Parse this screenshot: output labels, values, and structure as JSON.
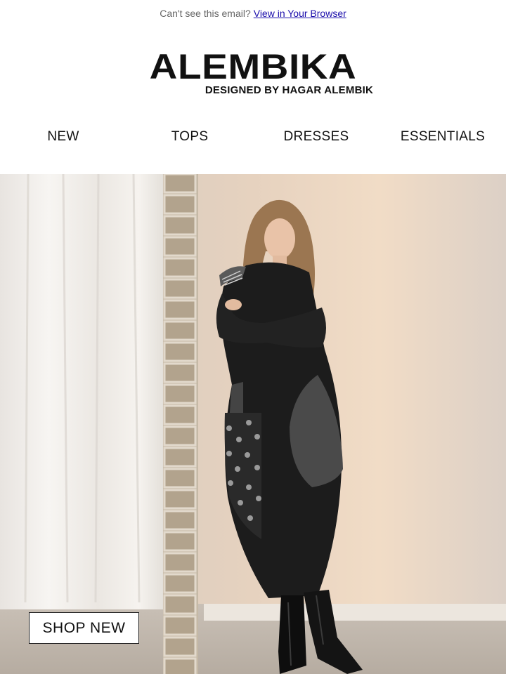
{
  "preheader": {
    "text": "Can't see this email?",
    "link_label": "View in Your Browser"
  },
  "brand": {
    "name": "ALEMBIKA",
    "tagline": "DESIGNED BY HAGAR ALEMBIK"
  },
  "nav": {
    "items": [
      {
        "label": "NEW"
      },
      {
        "label": "TOPS"
      },
      {
        "label": "DRESSES"
      },
      {
        "label": "ESSENTIALS"
      }
    ]
  },
  "hero": {
    "cta_label": "SHOP NEW"
  }
}
